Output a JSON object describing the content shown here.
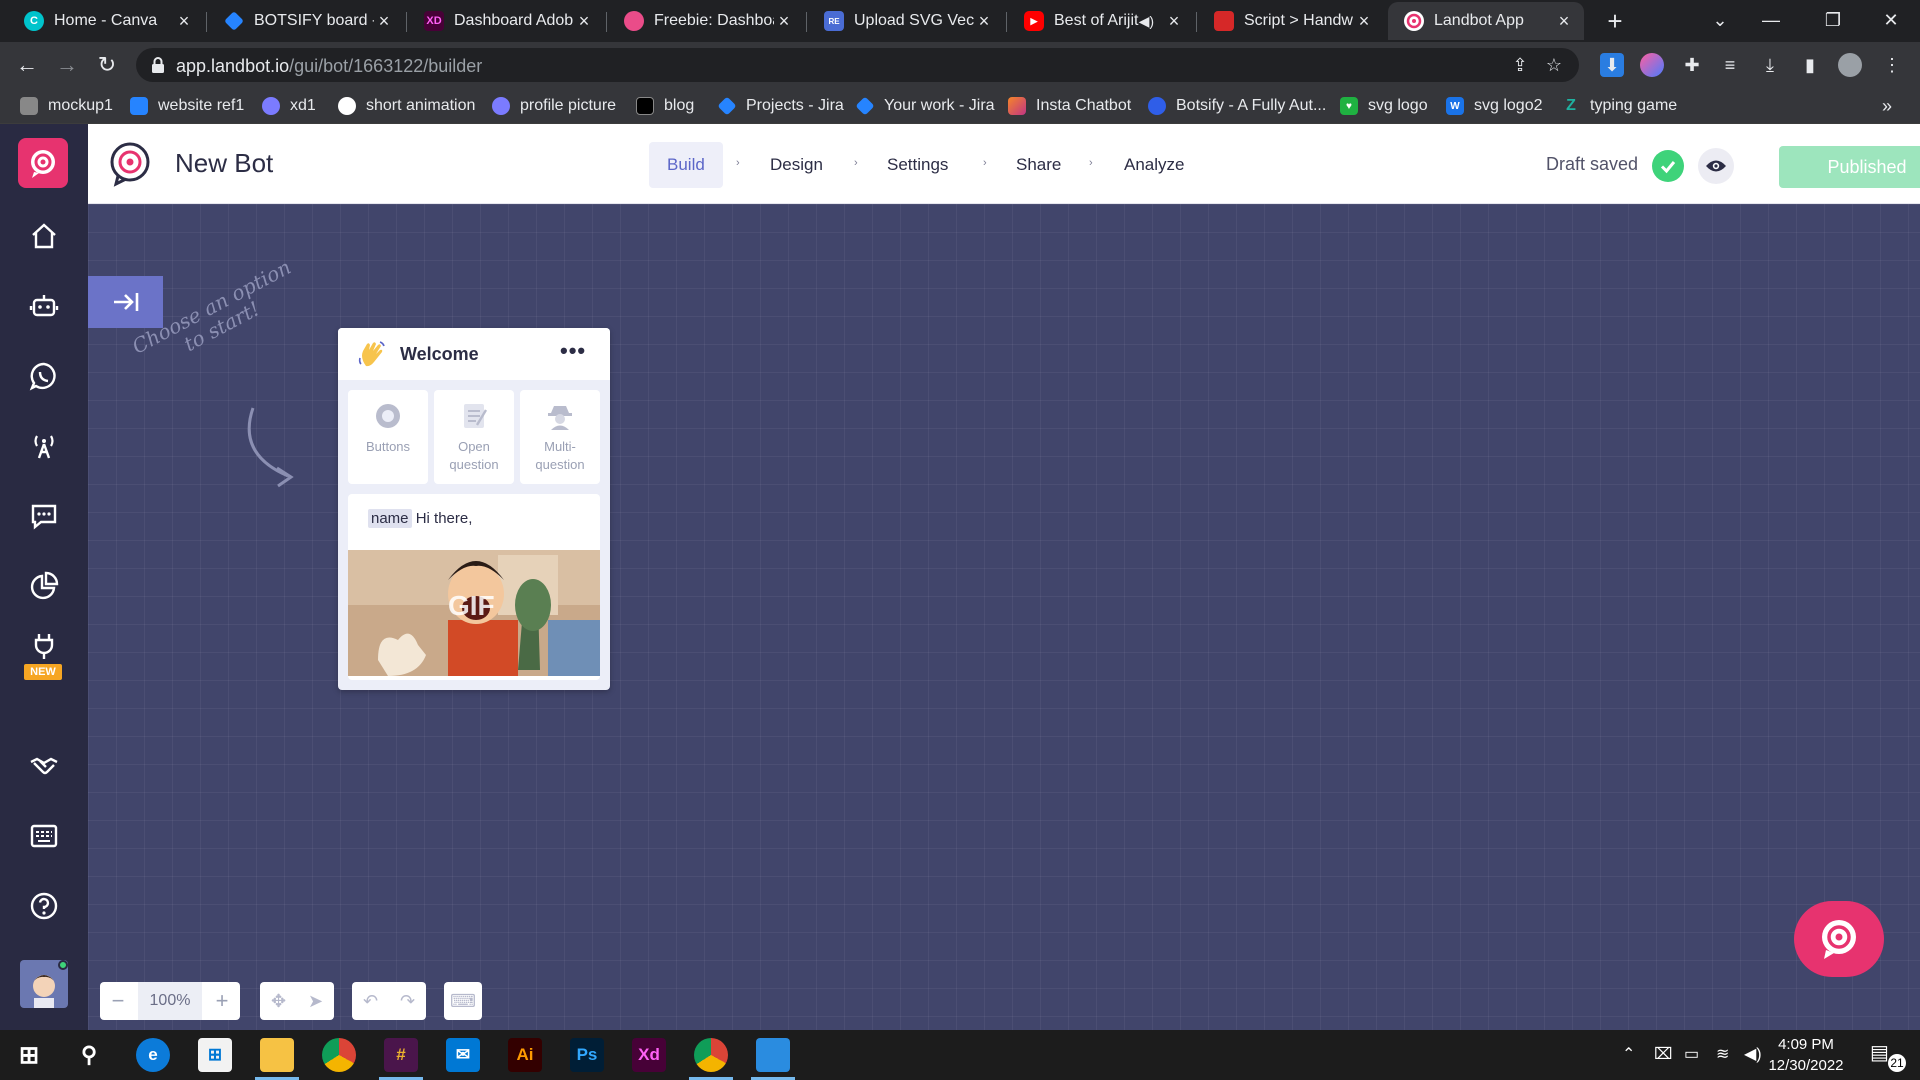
{
  "browser": {
    "tabs": [
      {
        "title": "Home - Canva",
        "favicon": "canva-icon",
        "color": "#00c4cc",
        "glyph": "C",
        "active": false
      },
      {
        "title": "BOTSIFY board - /",
        "favicon": "jira-icon",
        "color": "#2684ff",
        "glyph": "",
        "active": false
      },
      {
        "title": "Dashboard Adob",
        "favicon": "xd-icon",
        "color": "#470137",
        "glyph": "XD",
        "active": false
      },
      {
        "title": "Freebie: Dashboa",
        "favicon": "dribbble-icon",
        "color": "#ea4c89",
        "glyph": "",
        "active": false
      },
      {
        "title": "Upload SVG Vect",
        "favicon": "svg-repo-icon",
        "color": "#4a6cd4",
        "glyph": "RE",
        "active": false
      },
      {
        "title": "Best of Arijit",
        "favicon": "youtube-icon",
        "color": "#ff0000",
        "glyph": "▶",
        "active": false
      },
      {
        "title": "Script > Handwrit",
        "favicon": "script-icon",
        "color": "#d62828",
        "glyph": "",
        "active": false
      },
      {
        "title": "Landbot App",
        "favicon": "landbot-icon",
        "color": "#e7336f",
        "glyph": "",
        "active": true
      }
    ],
    "new_tab": "+",
    "url_host": "app.landbot.io",
    "url_path": "/gui/bot/1663122/builder",
    "bookmarks": [
      {
        "label": "mockup1",
        "icon": "mockup-icon",
        "color": "#888888"
      },
      {
        "label": "website ref1",
        "icon": "link-icon",
        "color": "#2684ff"
      },
      {
        "label": "xd1",
        "icon": "crown-icon",
        "color": "#7b7bff"
      },
      {
        "label": "short animation",
        "icon": "circle-icon",
        "color": "#ffffff"
      },
      {
        "label": "profile picture",
        "icon": "user-icon",
        "color": "#7b7bff"
      },
      {
        "label": "blog",
        "icon": "blog-icon",
        "color": "#000000"
      },
      {
        "label": "Projects - Jira",
        "icon": "jira-icon",
        "color": "#2684ff"
      },
      {
        "label": "Your work - Jira",
        "icon": "jira-icon",
        "color": "#2684ff"
      },
      {
        "label": "Insta Chatbot",
        "icon": "insta-icon",
        "color": "#c13584"
      },
      {
        "label": "Botsify - A Fully Aut...",
        "icon": "botsify-icon",
        "color": "#2f5ee8"
      },
      {
        "label": "svg logo",
        "icon": "heart-icon",
        "color": "#1fb141"
      },
      {
        "label": "svg logo2",
        "icon": "w-icon",
        "color": "#1a73e8"
      },
      {
        "label": "typing game",
        "icon": "z-icon",
        "color": "#1fb1a0"
      }
    ],
    "bookmarks_more": "»"
  },
  "app": {
    "bot_name": "New Bot",
    "steps": [
      "Build",
      "Design",
      "Settings",
      "Share",
      "Analyze"
    ],
    "active_step": "Build",
    "draft_status": "Draft saved",
    "publish_label": "Published",
    "nav_new_badge": "NEW",
    "canvas_hint_line1": "Choose an option",
    "canvas_hint_line2": "to start!",
    "card": {
      "title": "Welcome",
      "menu": "•••",
      "options": [
        {
          "label_1": "Buttons",
          "label_2": ""
        },
        {
          "label_1": "Open",
          "label_2": "question"
        },
        {
          "label_1": "Multi-",
          "label_2": "question"
        }
      ],
      "message_variable": "name",
      "message_text": "Hi there,",
      "gif_label": "GIF"
    },
    "zoom": "100%",
    "zoom_minus": "−",
    "zoom_plus": "+"
  },
  "taskbar": {
    "time": "4:09 PM",
    "date": "12/30/2022",
    "notifications": "21",
    "apps": [
      {
        "name": "edge-icon",
        "color": "#0c7bd9",
        "glyph": "e"
      },
      {
        "name": "store-icon",
        "color": "#f2f2f2",
        "glyph": "⊞"
      },
      {
        "name": "explorer-icon",
        "color": "#f6c244",
        "glyph": ""
      },
      {
        "name": "chrome-icon",
        "color": "#db4437",
        "glyph": ""
      },
      {
        "name": "slack-icon",
        "color": "#4a154b",
        "glyph": "#"
      },
      {
        "name": "mail-icon",
        "color": "#0078d4",
        "glyph": "✉"
      },
      {
        "name": "illustrator-icon",
        "color": "#330000",
        "glyph": "Ai"
      },
      {
        "name": "photoshop-icon",
        "color": "#001e36",
        "glyph": "Ps"
      },
      {
        "name": "xd-app-icon",
        "color": "#470137",
        "glyph": "Xd"
      },
      {
        "name": "chrome-profile-icon",
        "color": "#5f6368",
        "glyph": ""
      },
      {
        "name": "photos-icon",
        "color": "#2a8ce0",
        "glyph": ""
      }
    ]
  },
  "colors": {
    "brand": "#e7336f",
    "canvas": "#41456b",
    "sidebar": "#292a42",
    "accent": "#5c66c8",
    "success": "#3ed37a"
  }
}
